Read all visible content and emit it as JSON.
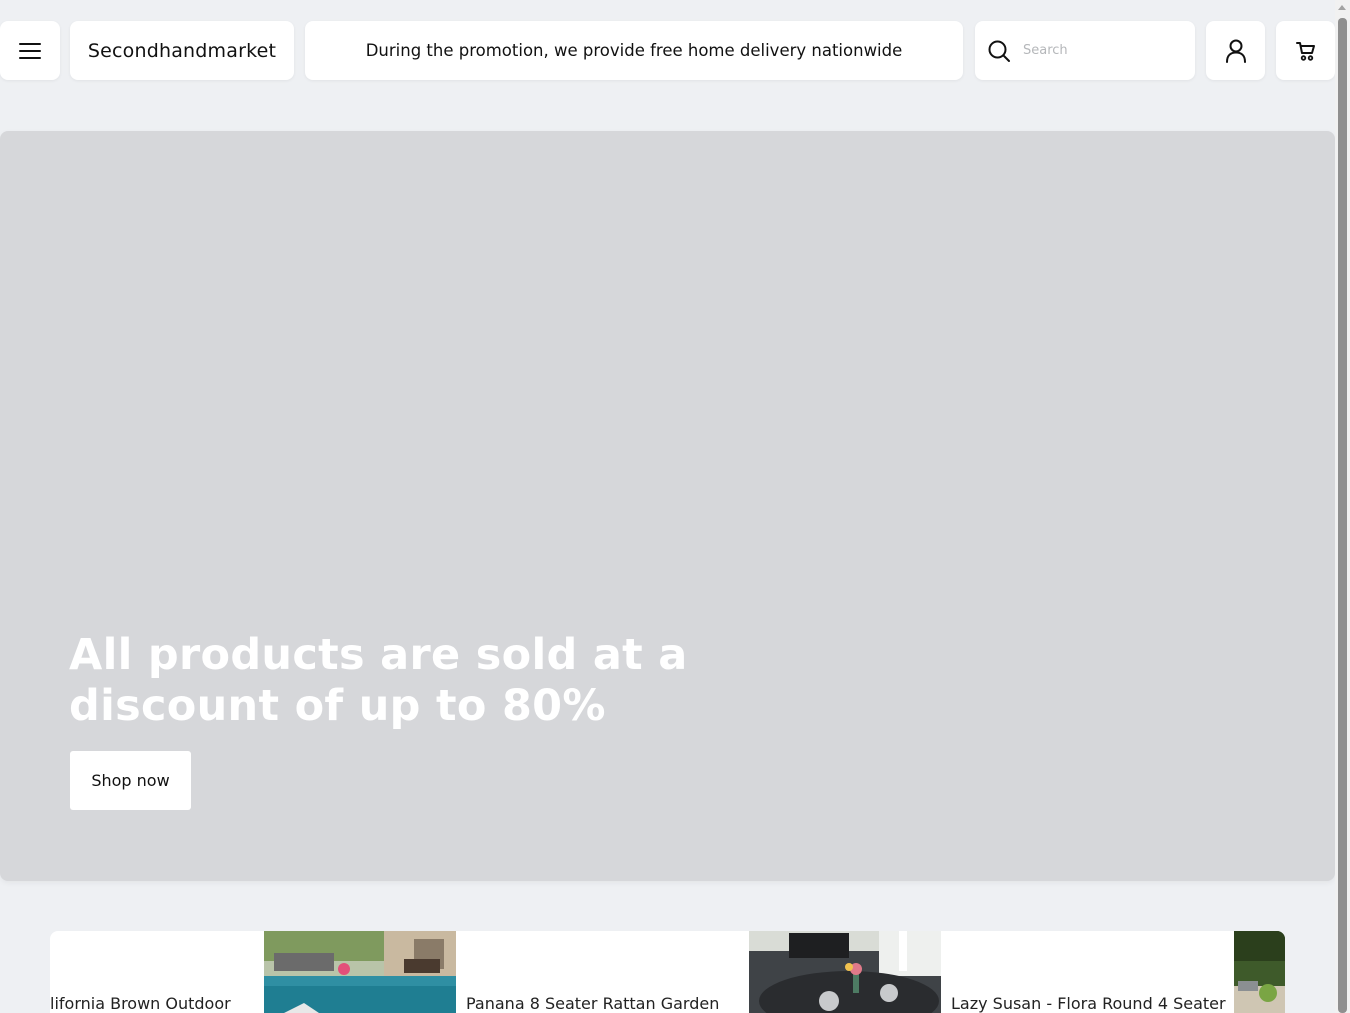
{
  "header": {
    "brand": "Secondhandmarket",
    "promo": "During the promotion, we provide free home delivery nationwide",
    "search_placeholder": "Search"
  },
  "hero": {
    "title": "All products are sold at a discount of up to 80%",
    "cta": "Shop now"
  },
  "products": [
    {
      "name": "lifornia Brown Outdoor"
    },
    {
      "name": "Panana 8 Seater Rattan Garden"
    },
    {
      "name": "Lazy Susan - Flora Round 4 Seater"
    }
  ],
  "icons": {
    "menu": "hamburger-icon",
    "search": "search-icon",
    "user": "user-icon",
    "cart": "cart-icon"
  }
}
